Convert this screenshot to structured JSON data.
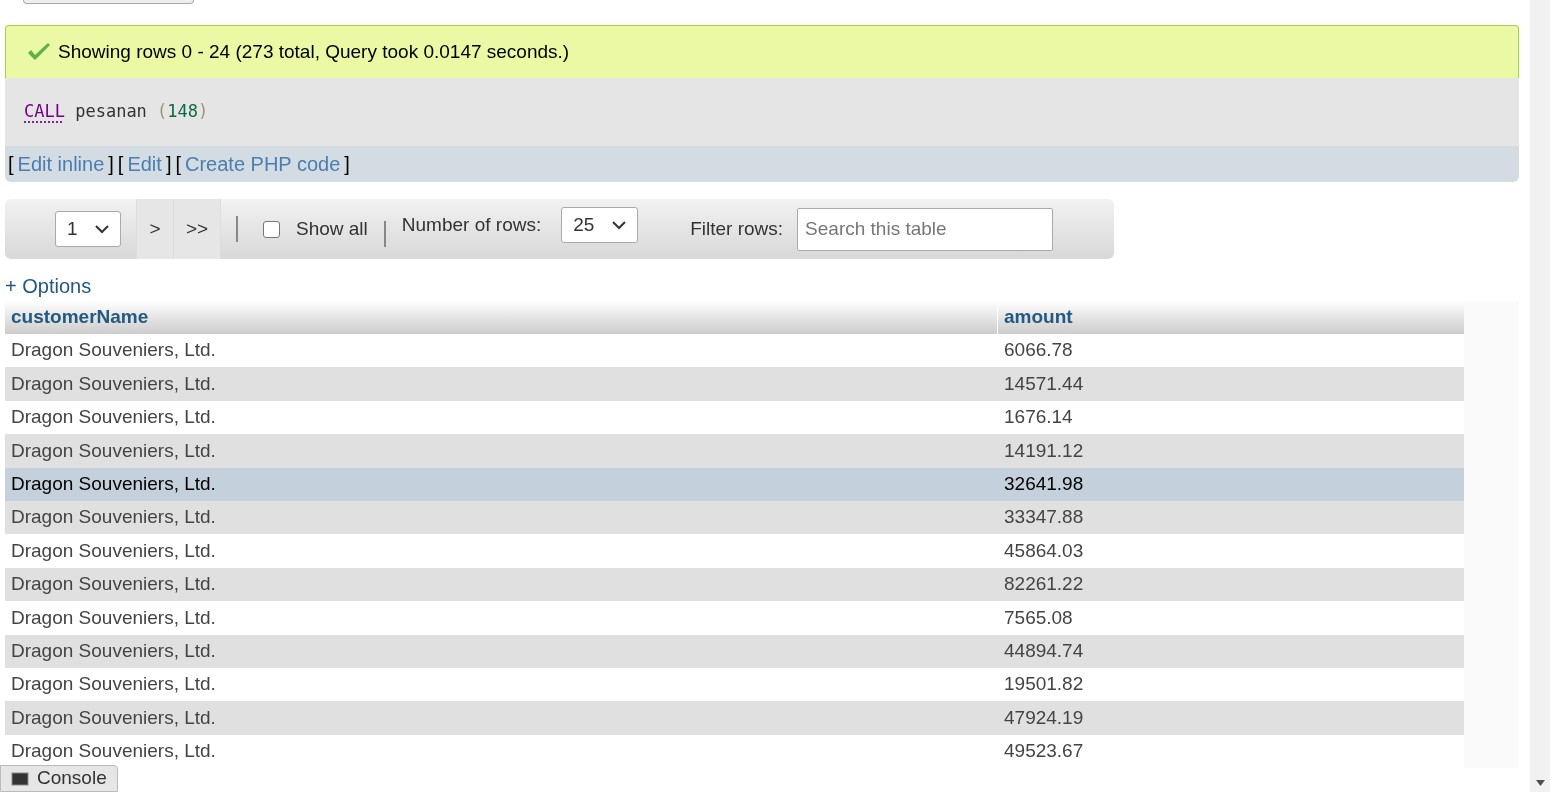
{
  "success": {
    "message": "Showing rows 0 - 24 (273 total, Query took 0.0147 seconds.)"
  },
  "sql": {
    "keyword": "CALL",
    "name": "pesanan",
    "open": "(",
    "arg": "148",
    "close": ")"
  },
  "links": [
    {
      "open": "[",
      "label": "Edit inline",
      "close": "]"
    },
    {
      "open": "[",
      "label": "Edit",
      "close": "]"
    },
    {
      "open": "[",
      "label": "Create PHP code",
      "close": "]"
    }
  ],
  "navigation": {
    "page": "1",
    "next": ">",
    "last": ">>",
    "show_all": {
      "label": "Show all",
      "checked": false
    },
    "rows_label": "Number of rows:",
    "rows_value": "25",
    "filter_label": "Filter rows:",
    "filter_placeholder": "Search this table"
  },
  "options_link": "+ Options",
  "table": {
    "columns": [
      "customerName",
      "amount"
    ],
    "rows": [
      {
        "cells": [
          "Dragon Souveniers, Ltd.",
          "6066.78"
        ],
        "selected": false
      },
      {
        "cells": [
          "Dragon Souveniers, Ltd.",
          "14571.44"
        ],
        "selected": false
      },
      {
        "cells": [
          "Dragon Souveniers, Ltd.",
          "1676.14"
        ],
        "selected": false
      },
      {
        "cells": [
          "Dragon Souveniers, Ltd.",
          "14191.12"
        ],
        "selected": false
      },
      {
        "cells": [
          "Dragon Souveniers, Ltd.",
          "32641.98"
        ],
        "selected": true
      },
      {
        "cells": [
          "Dragon Souveniers, Ltd.",
          "33347.88"
        ],
        "selected": false
      },
      {
        "cells": [
          "Dragon Souveniers, Ltd.",
          "45864.03"
        ],
        "selected": false
      },
      {
        "cells": [
          "Dragon Souveniers, Ltd.",
          "82261.22"
        ],
        "selected": false
      },
      {
        "cells": [
          "Dragon Souveniers, Ltd.",
          "7565.08"
        ],
        "selected": false
      },
      {
        "cells": [
          "Dragon Souveniers, Ltd.",
          "44894.74"
        ],
        "selected": false
      },
      {
        "cells": [
          "Dragon Souveniers, Ltd.",
          "19501.82"
        ],
        "selected": false
      },
      {
        "cells": [
          "Dragon Souveniers, Ltd.",
          "47924.19"
        ],
        "selected": false
      },
      {
        "cells": [
          "Dragon Souveniers, Ltd.",
          "49523.67"
        ],
        "selected": false
      }
    ]
  },
  "console": {
    "label": "Console"
  }
}
